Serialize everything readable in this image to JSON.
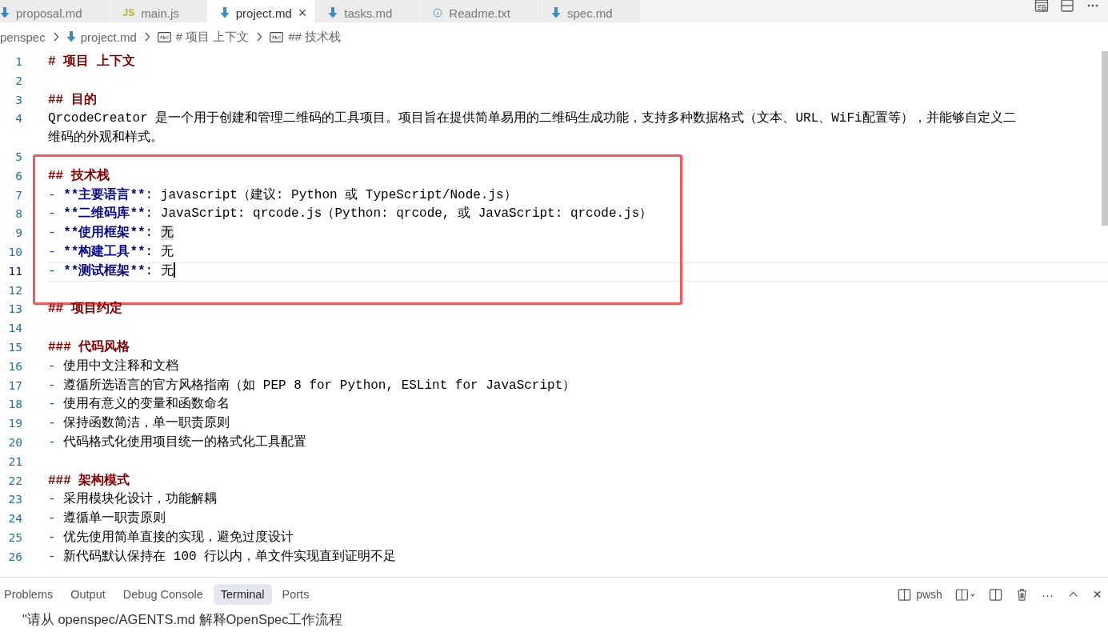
{
  "tabs": [
    {
      "label": "proposal.md",
      "kind": "markdown",
      "selected": false
    },
    {
      "label": "main.js",
      "kind": "js",
      "icon_text": "JS",
      "selected": false
    },
    {
      "label": "project.md",
      "kind": "markdown",
      "selected": true,
      "close": "×"
    },
    {
      "label": "tasks.md",
      "kind": "markdown",
      "selected": false
    },
    {
      "label": "Readme.txt",
      "kind": "info",
      "selected": false
    },
    {
      "label": "spec.md",
      "kind": "markdown",
      "selected": false
    }
  ],
  "breadcrumb": [
    {
      "label": "penspec"
    },
    {
      "label": "project.md",
      "kind": "markdown"
    },
    {
      "label": "# 项目 上下文",
      "kind": "symbol"
    },
    {
      "label": "## 技术栈",
      "kind": "symbol"
    }
  ],
  "blocks": [
    {
      "lines": [
        {
          "number": "1",
          "current": false,
          "segments": [
            {
              "kind": "heading",
              "text": "# 项目 上下文"
            }
          ]
        },
        {
          "number": "2",
          "current": false
        },
        {
          "number": "3",
          "current": false,
          "segments": [
            {
              "kind": "heading",
              "text": "## 目的"
            }
          ]
        },
        {
          "number": "4",
          "current": false,
          "segments": [
            {
              "kind": "plain",
              "text": "QrcodeCreator 是一个用于创建和管理二维码的工具项目。项目旨在提供简单易用的二维码生成功能，支持多种数据格式（文本、URL、WiFi配置等），并能够自定义二维码的外观和样式。"
            }
          ]
        }
      ]
    },
    {
      "boxed": true,
      "lines": [
        {
          "number": "5",
          "current": false
        },
        {
          "number": "6",
          "current": false,
          "segments": [
            {
              "kind": "heading",
              "text": "## 技术栈"
            }
          ]
        },
        {
          "number": "7",
          "current": false,
          "segments": [
            {
              "kind": "dash",
              "text": "- "
            },
            {
              "kind": "bold",
              "text": "**主要语言**"
            },
            {
              "kind": "plain",
              "text": ": javascript（建议: Python 或 TypeScript/Node.js）"
            }
          ]
        },
        {
          "number": "8",
          "current": false,
          "segments": [
            {
              "kind": "dash",
              "text": "- "
            },
            {
              "kind": "bold",
              "text": "**二维码库**"
            },
            {
              "kind": "plain",
              "text": ": JavaScript: qrcode.js（Python: qrcode, 或 JavaScript: qrcode.js）"
            }
          ]
        },
        {
          "number": "9",
          "current": false,
          "segments": [
            {
              "kind": "dash",
              "text": "- "
            },
            {
              "kind": "bold",
              "text": "**使用框架**"
            },
            {
              "kind": "plain",
              "text": ": "
            },
            {
              "kind": "match",
              "text": "无"
            }
          ]
        },
        {
          "number": "10",
          "current": false,
          "segments": [
            {
              "kind": "dash",
              "text": "- "
            },
            {
              "kind": "bold",
              "text": "**构建工具**"
            },
            {
              "kind": "plain",
              "text": ": 无"
            }
          ]
        },
        {
          "number": "11",
          "current": true,
          "segments": [
            {
              "kind": "dash",
              "text": "- "
            },
            {
              "kind": "bold",
              "text": "**测试框架**"
            },
            {
              "kind": "plain",
              "text": ": 无"
            }
          ]
        },
        {
          "number": "12",
          "current": false
        }
      ]
    },
    {
      "lines": [
        {
          "number": "13",
          "current": false,
          "segments": [
            {
              "kind": "heading",
              "text": "## 项目约定"
            }
          ]
        },
        {
          "number": "14",
          "current": false
        },
        {
          "number": "15",
          "current": false,
          "segments": [
            {
              "kind": "heading",
              "text": "### 代码风格"
            }
          ]
        },
        {
          "number": "16",
          "current": false,
          "segments": [
            {
              "kind": "dash",
              "text": "- "
            },
            {
              "kind": "plain",
              "text": "使用中文注释和文档"
            }
          ]
        },
        {
          "number": "17",
          "current": false,
          "segments": [
            {
              "kind": "dash",
              "text": "- "
            },
            {
              "kind": "plain",
              "text": "遵循所选语言的官方风格指南（如 PEP 8 for Python, ESLint for JavaScript）"
            }
          ]
        },
        {
          "number": "18",
          "current": false,
          "segments": [
            {
              "kind": "dash",
              "text": "- "
            },
            {
              "kind": "plain",
              "text": "使用有意义的变量和函数命名"
            }
          ]
        },
        {
          "number": "19",
          "current": false,
          "segments": [
            {
              "kind": "dash",
              "text": "- "
            },
            {
              "kind": "plain",
              "text": "保持函数简洁，单一职责原则"
            }
          ]
        },
        {
          "number": "20",
          "current": false,
          "segments": [
            {
              "kind": "dash",
              "text": "- "
            },
            {
              "kind": "plain",
              "text": "代码格式化使用项目统一的格式化工具配置"
            }
          ]
        },
        {
          "number": "21",
          "current": false
        },
        {
          "number": "22",
          "current": false,
          "segments": [
            {
              "kind": "heading",
              "text": "### 架构模式"
            }
          ]
        },
        {
          "number": "23",
          "current": false,
          "segments": [
            {
              "kind": "dash",
              "text": "- "
            },
            {
              "kind": "plain",
              "text": "采用模块化设计，功能解耦"
            }
          ]
        },
        {
          "number": "24",
          "current": false,
          "segments": [
            {
              "kind": "dash",
              "text": "- "
            },
            {
              "kind": "plain",
              "text": "遵循单一职责原则"
            }
          ]
        },
        {
          "number": "25",
          "current": false,
          "segments": [
            {
              "kind": "dash",
              "text": "- "
            },
            {
              "kind": "plain",
              "text": "优先使用简单直接的实现，避免过度设计"
            }
          ]
        },
        {
          "number": "26",
          "current": false,
          "segments": [
            {
              "kind": "dash",
              "text": "- "
            },
            {
              "kind": "plain",
              "text": "新代码默认保持在 100 行以内，单文件实现直到证明不足"
            }
          ]
        }
      ]
    }
  ],
  "panel": {
    "tabs": [
      {
        "label": "Problems",
        "selected": false
      },
      {
        "label": "Output",
        "selected": false
      },
      {
        "label": "Debug Console",
        "selected": false
      },
      {
        "label": "Terminal",
        "selected": true
      },
      {
        "label": "Ports",
        "selected": false
      }
    ],
    "terminal_name": "pwsh",
    "more": "···",
    "close": "×",
    "terminal_lines": [
      "\"请从 openspec/AGENTS.md 解释OpenSpec工作流程"
    ]
  }
}
